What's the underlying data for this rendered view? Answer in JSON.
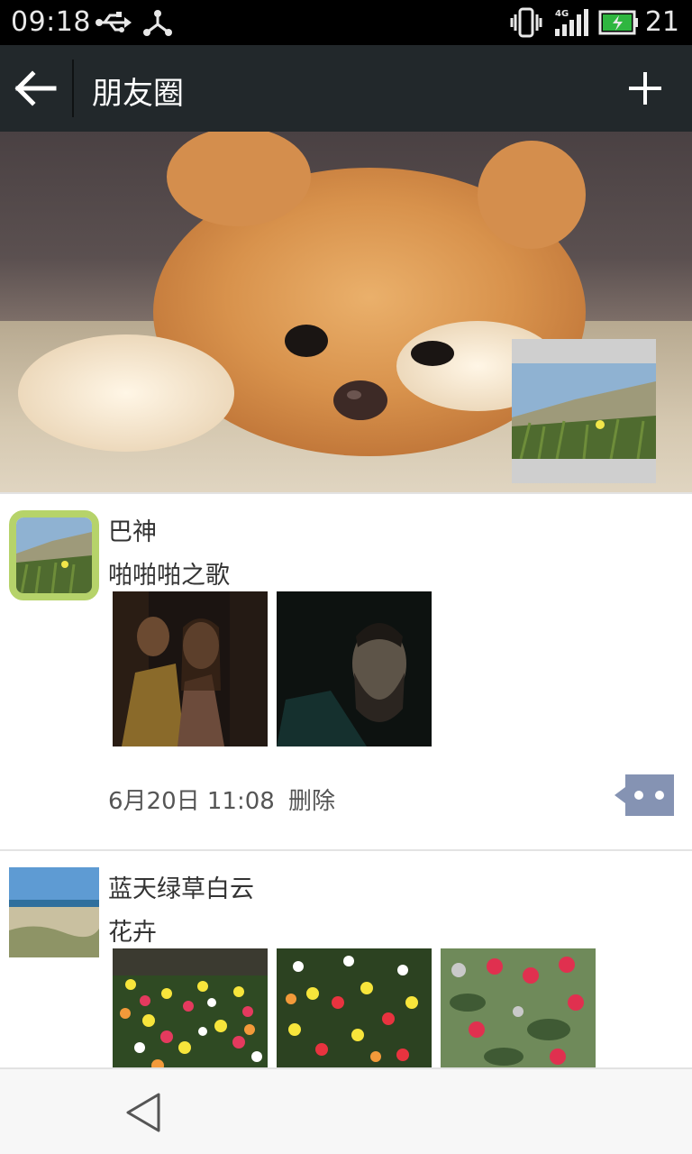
{
  "status_bar": {
    "time": "09:18",
    "network": "4G",
    "battery": "21",
    "icons": [
      "usb-icon",
      "hotspot-icon",
      "vibrate-icon",
      "signal-icon",
      "battery-charging-icon"
    ]
  },
  "app_bar": {
    "title": "朋友圈",
    "back_icon": "back-arrow-icon",
    "add_icon": "plus-icon"
  },
  "posts": [
    {
      "name": "巴神",
      "text": "啪啪啪之歌",
      "time": "6月20日 11:08",
      "delete_label": "删除",
      "photos": [
        "dark-scene-couple",
        "dark-scene-man"
      ]
    },
    {
      "name": "蓝天绿草白云",
      "text": "花卉",
      "photos": [
        "flower-field",
        "flower-field",
        "red-flowers"
      ]
    }
  ],
  "nav_bar": {
    "back_icon": "nav-back-icon"
  },
  "colors": {
    "status_bg": "#000000",
    "app_bar_bg": "#22282b",
    "accent_ring": "#b6d36a",
    "more_button": "#8593b3"
  }
}
